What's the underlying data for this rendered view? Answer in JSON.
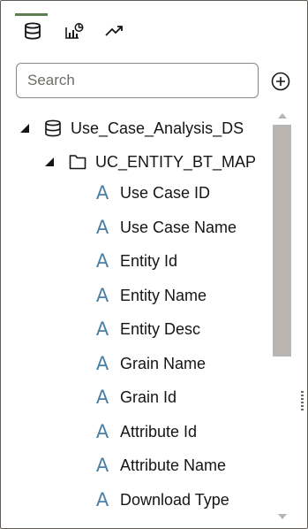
{
  "toolbar": {
    "tabs": [
      {
        "icon": "database-icon",
        "active": true
      },
      {
        "icon": "chart-icon",
        "active": false
      },
      {
        "icon": "trend-icon",
        "active": false
      }
    ],
    "accent_color": "#5c7f51"
  },
  "search": {
    "placeholder": "Search",
    "value": ""
  },
  "add_button": {
    "icon": "add-circle-icon"
  },
  "tree": {
    "dataset": {
      "label": "Use_Case_Analysis_DS",
      "icon": "database-icon",
      "expanded": true
    },
    "table": {
      "label": "UC_ENTITY_BT_MAP",
      "icon": "folder-icon",
      "expanded": true
    },
    "attributes": [
      {
        "label": "Use Case ID",
        "type_glyph": "A"
      },
      {
        "label": "Use Case Name",
        "type_glyph": "A"
      },
      {
        "label": "Entity Id",
        "type_glyph": "A"
      },
      {
        "label": "Entity Name",
        "type_glyph": "A"
      },
      {
        "label": "Entity Desc",
        "type_glyph": "A"
      },
      {
        "label": "Grain Name",
        "type_glyph": "A"
      },
      {
        "label": "Grain Id",
        "type_glyph": "A"
      },
      {
        "label": "Attribute Id",
        "type_glyph": "A"
      },
      {
        "label": "Attribute Name",
        "type_glyph": "A"
      },
      {
        "label": "Download Type",
        "type_glyph": "A"
      }
    ],
    "attribute_glyph_color": "#4a7fa6"
  }
}
